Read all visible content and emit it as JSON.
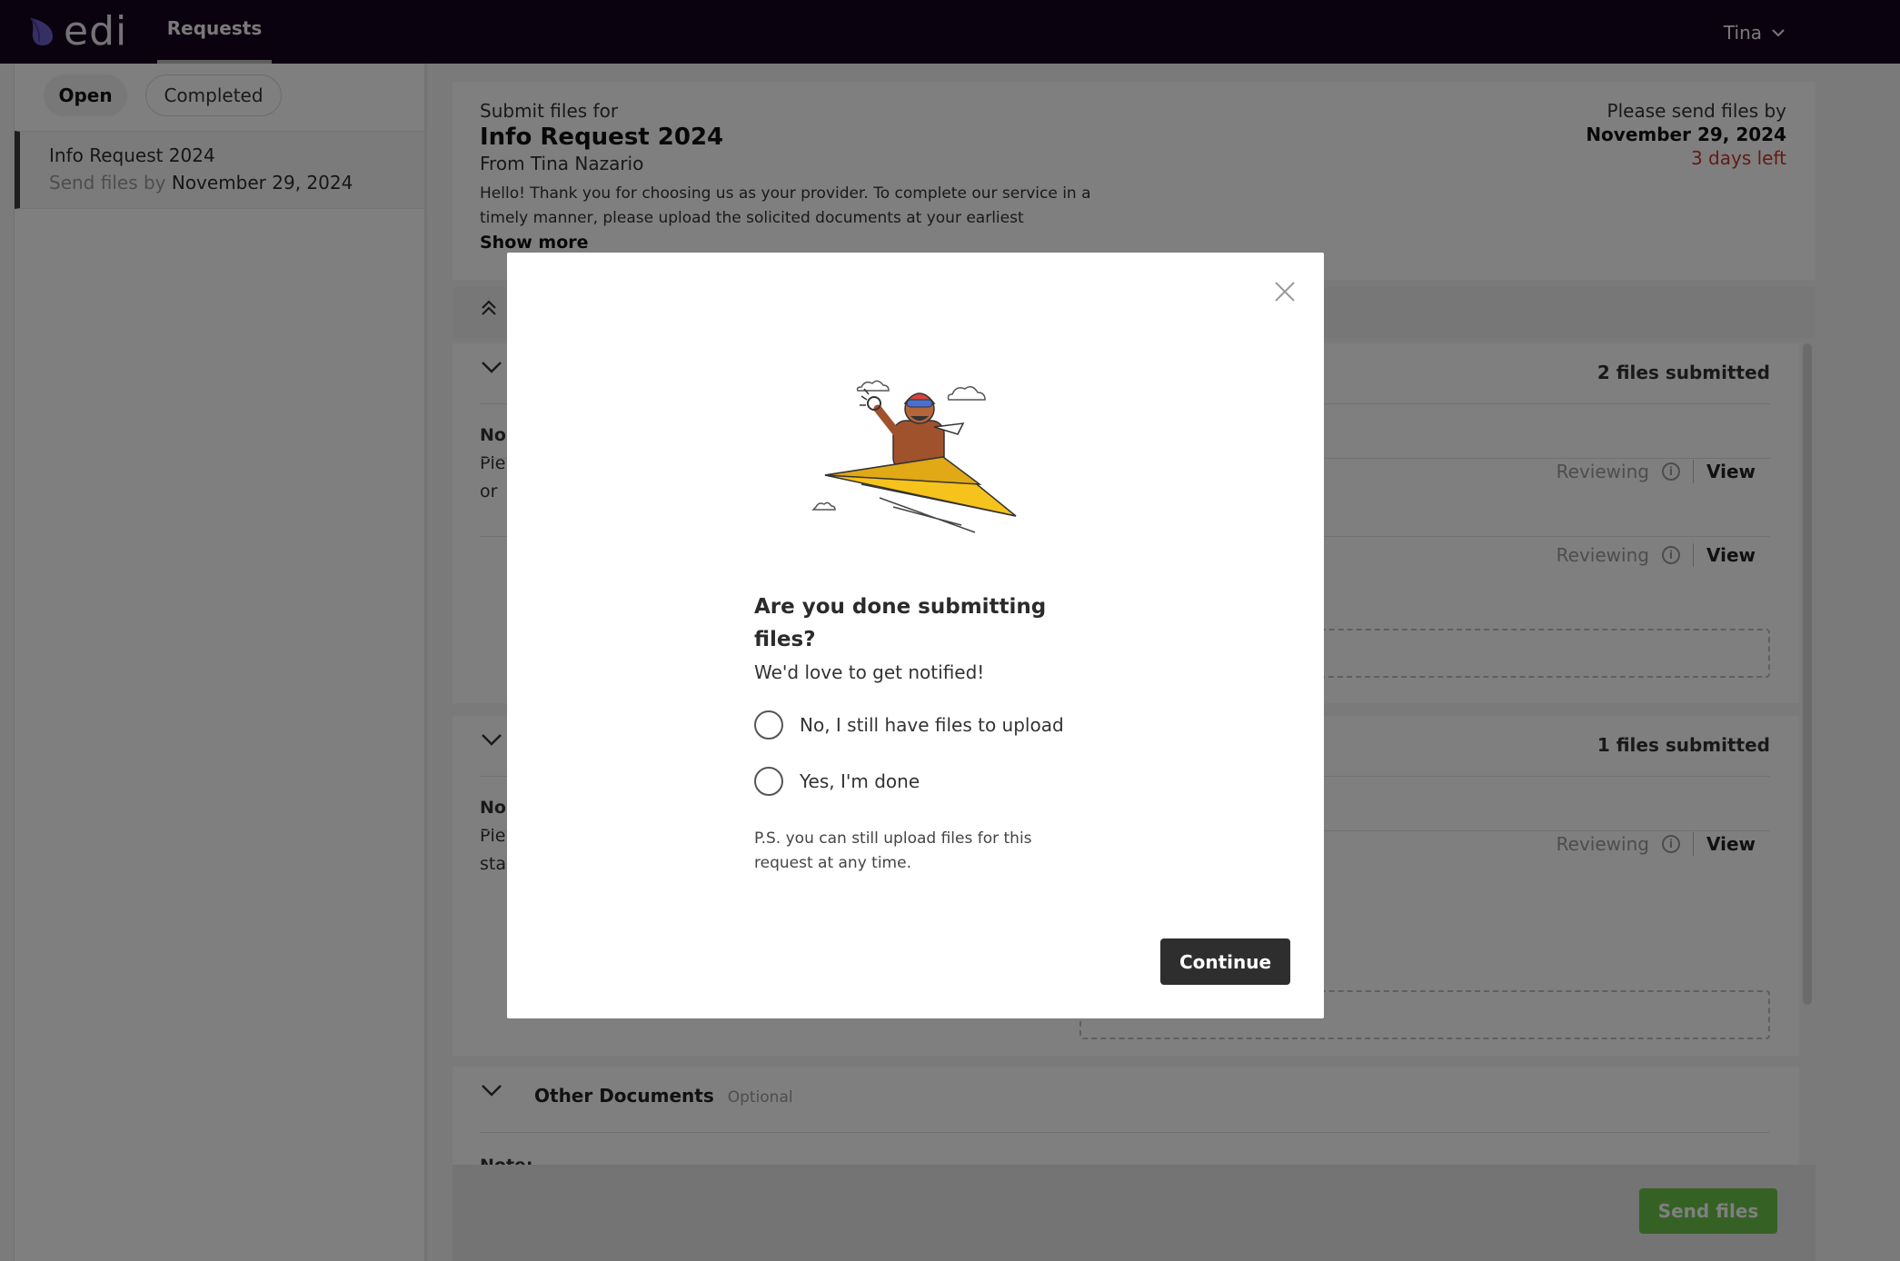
{
  "topbar": {
    "logo_text": "edi",
    "nav_tab": "Requests",
    "user_name": "Tina"
  },
  "sidebar": {
    "filters": {
      "open": "Open",
      "completed": "Completed"
    },
    "items": [
      {
        "title": "Info Request 2024",
        "send_prefix": "Send files by",
        "due": "November 29, 2024"
      }
    ]
  },
  "request": {
    "pre_title": "Submit files for",
    "title": "Info Request 2024",
    "from": "From Tina Nazario",
    "description": "Hello! Thank you for choosing us as your provider. To complete our service in a timely manner, please upload the solicited documents at your earliest",
    "show_more": "Show more",
    "deadline_label": "Please send files by",
    "deadline": "November 29, 2024",
    "days_left": "3 days left"
  },
  "sections": [
    {
      "count": "2 files submitted",
      "note_lines": [
        "No",
        "Ple",
        "or"
      ],
      "files": [
        {
          "status": "Reviewing",
          "action": "View"
        },
        {
          "status": "Reviewing",
          "action": "View"
        }
      ]
    },
    {
      "count": "1 files submitted",
      "note_lines": [
        "No",
        "Ple",
        "sta"
      ],
      "files": [
        {
          "status": "Reviewing",
          "action": "View"
        }
      ]
    },
    {
      "title": "Other Documents",
      "optional": "Optional",
      "note_label": "Note:"
    }
  ],
  "footer": {
    "send_button": "Send files"
  },
  "modal": {
    "title": "Are you done submitting files?",
    "subtitle": "We'd love to get notified!",
    "options": [
      "No, I still have files to upload",
      "Yes, I'm done"
    ],
    "ps": "P.S. you can still upload files for this request at any time.",
    "continue_button": "Continue"
  },
  "colors": {
    "topbar": "#16051f",
    "accent_red": "#c0392b",
    "send_button": "#6cc24a",
    "continue_button": "#2e2e2e",
    "illustration_plane": "#f6c21c"
  }
}
